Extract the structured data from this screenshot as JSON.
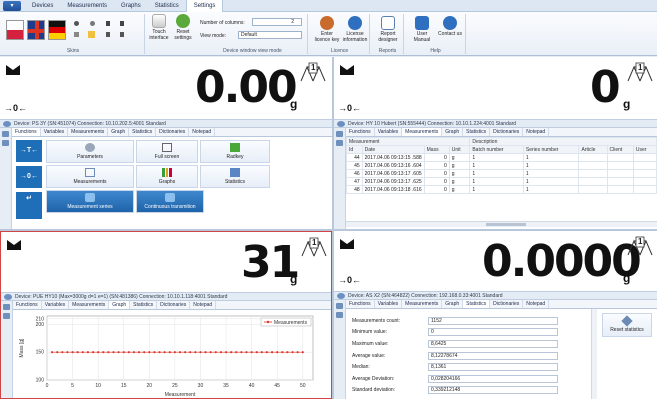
{
  "ribbon": {
    "app_button": "▾",
    "tabs": [
      "Devices",
      "Measurements",
      "Graphs",
      "Statistics",
      "Settings"
    ],
    "active_tab": "Settings",
    "groups": {
      "skins": "Skins",
      "touch": "Touch interface",
      "reset": "Reset settings",
      "columns_label": "Number of columns:",
      "columns_value": "2",
      "view_mode_label": "View mode:",
      "view_mode_value": "Default",
      "view_group": "Device window view mode",
      "enter_key": "Enter licence key",
      "license_info": "License information",
      "licence_group": "Licence",
      "report_designer": "Report designer",
      "reports_group": "Reports",
      "user_manual": "User Manual",
      "contact": "Contact us",
      "help_group": "Help"
    }
  },
  "panels": [
    {
      "reading": "0.00",
      "unit": "g",
      "zero": "→0←",
      "range": "1",
      "device": "Device: PS 3Y (SN:451074)   Connection: 10.10.202.5:4001   Standard",
      "tabs": [
        "Functions",
        "Variables",
        "Measurements",
        "Graph",
        "Statistics",
        "Dictionaries",
        "Notepad"
      ],
      "active": "Functions",
      "functions": {
        "tare": "→T←",
        "zero": "→0←",
        "enter": "↵",
        "buttons": [
          "Parameters",
          "Full screen",
          "Radkey",
          "Measurements",
          "Graphs",
          "Statistics",
          "Measurement series",
          "Continuous transmition"
        ]
      }
    },
    {
      "reading": "0",
      "unit": "g",
      "zero": "→0←",
      "range": "1",
      "device": "Device: HY 10 Hubert (SN:555444)   Connection: 10.10.1.224:4001   Standard",
      "tabs": [
        "Functions",
        "Variables",
        "Measurements",
        "Graph",
        "Statistics",
        "Dictionaries",
        "Notepad"
      ],
      "active": "Measurements",
      "table": {
        "group_measurement": "Measurement",
        "group_description": "Description",
        "headers": [
          "Id",
          "Date",
          "Mass",
          "Unit",
          "Batch number",
          "Series number",
          "Article",
          "Client",
          "User"
        ],
        "rows": [
          [
            "44",
            "2017.04.06  09:13:15 .588",
            "0",
            "g",
            "1",
            "1",
            "",
            "",
            ""
          ],
          [
            "45",
            "2017.04.06  09:13:16 .604",
            "0",
            "g",
            "1",
            "1",
            "",
            "",
            ""
          ],
          [
            "46",
            "2017.04.06  09:13:17 .605",
            "0",
            "g",
            "1",
            "1",
            "",
            "",
            ""
          ],
          [
            "47",
            "2017.04.06  09:13:17 .625",
            "0",
            "g",
            "1",
            "1",
            "",
            "",
            ""
          ],
          [
            "48",
            "2017.04.06  09:13:18 .616",
            "0",
            "g",
            "1",
            "1",
            "",
            "",
            ""
          ]
        ]
      }
    },
    {
      "reading": "31",
      "unit": "g",
      "zero": "",
      "range": "1",
      "device": "Device: PUE HY10 (Max=3000g  d=1  e=1) (SN:481386)   Connection: 10.10.1.118:4001   Standard",
      "tabs": [
        "Functions",
        "Variables",
        "Measurements",
        "Graph",
        "Statistics",
        "Dictionaries",
        "Notepad"
      ],
      "active": "Graph"
    },
    {
      "reading": "0.0000",
      "unit": "g",
      "zero": "→0←",
      "range": "1",
      "device": "Device: AS X2 (SN:464822)   Connection: 192.168.0.33:4001   Standard",
      "tabs": [
        "Functions",
        "Variables",
        "Measurements",
        "Graph",
        "Statistics",
        "Dictionaries",
        "Notepad"
      ],
      "active": "Statistics",
      "stats": {
        "labels": [
          "Measurements count:",
          "Minimum value:",
          "Maximum value:",
          "Average value:",
          "Median:",
          "Average Deviation:",
          "Standard deviation:"
        ],
        "values": [
          "1152",
          "0",
          "8,6425",
          "8,12278674",
          "8,1361",
          "0,028204166",
          "0,339212148"
        ],
        "reset": "Reset statistics"
      }
    }
  ],
  "chart_data": {
    "type": "line",
    "series": [
      {
        "name": "Measurements",
        "color": "#d9342b",
        "x": [
          1,
          2,
          3,
          4,
          5,
          6,
          7,
          8,
          9,
          10,
          11,
          12,
          13,
          14,
          15,
          16,
          17,
          18,
          19,
          20,
          21,
          22,
          23,
          24,
          25,
          26,
          27,
          28,
          29,
          30,
          31,
          32,
          33,
          34,
          35,
          36,
          37,
          38,
          39,
          40,
          41,
          42,
          43,
          44,
          45,
          46,
          47,
          48,
          49,
          50
        ],
        "values": [
          150,
          150,
          150,
          150,
          150,
          150,
          150,
          150,
          150,
          150,
          150,
          150,
          150,
          150,
          150,
          150,
          150,
          150,
          150,
          150,
          150,
          150,
          150,
          150,
          150,
          150,
          150,
          150,
          150,
          150,
          150,
          150,
          150,
          150,
          150,
          150,
          150,
          150,
          150,
          150,
          150,
          150,
          150,
          150,
          150,
          150,
          150,
          150,
          150,
          150
        ]
      }
    ],
    "xlabel": "Measurement",
    "ylabel": "Mass [g]",
    "xticks": [
      0,
      5,
      10,
      15,
      20,
      25,
      30,
      35,
      40,
      45,
      50
    ],
    "yticks": [
      100,
      150,
      200,
      210
    ],
    "xlim": [
      0,
      52
    ],
    "ylim": [
      100,
      215
    ],
    "grid": true,
    "legend": "top-right"
  }
}
